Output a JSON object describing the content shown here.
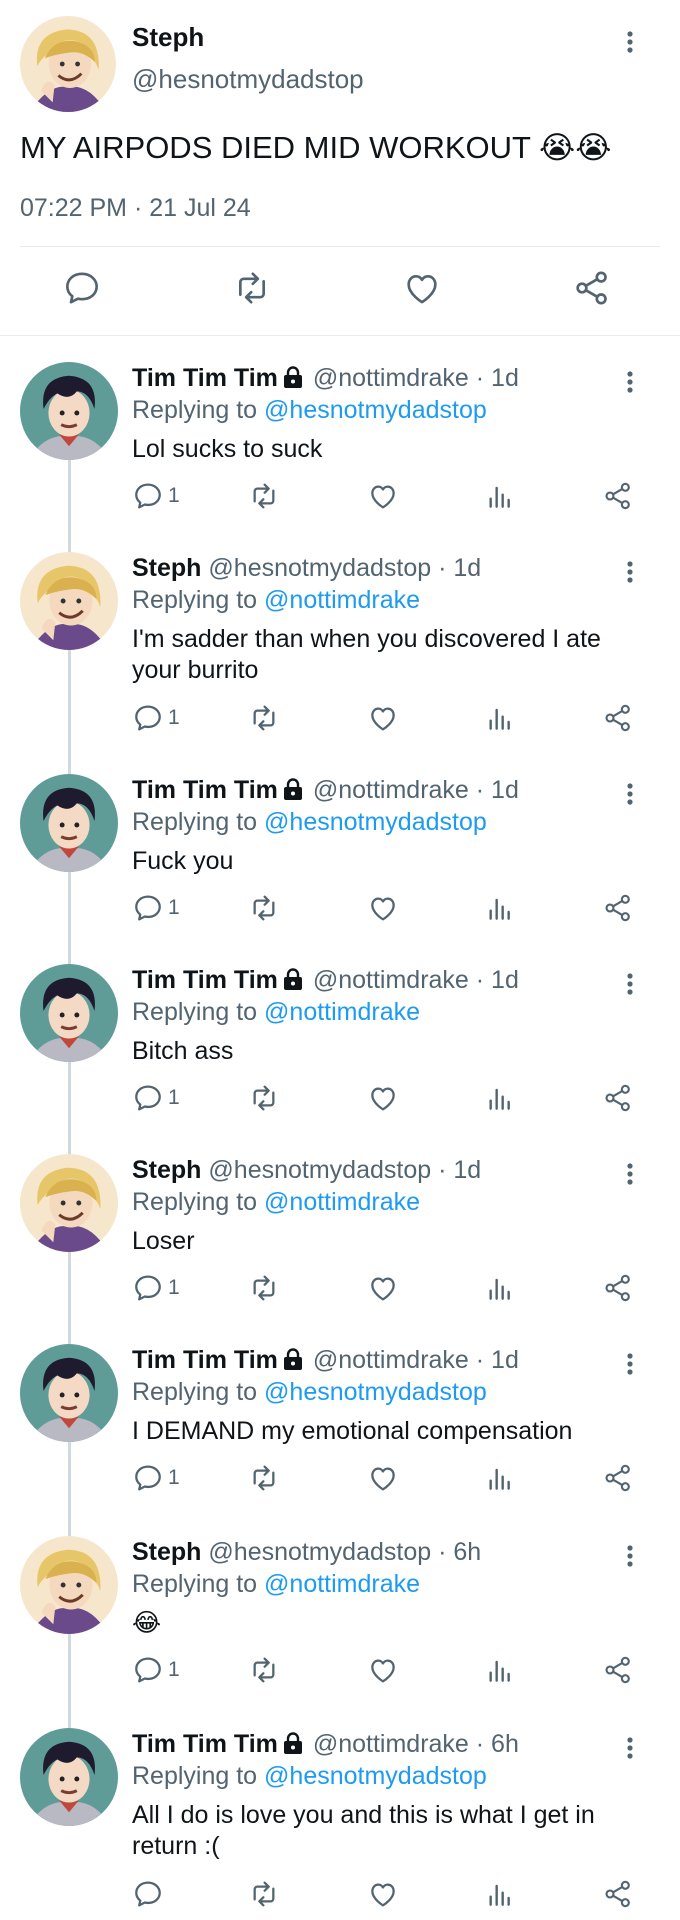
{
  "main_tweet": {
    "name": "Steph",
    "handle": "@hesnotmydadstop",
    "text": "MY AIRPODS DIED MID WORKOUT 😭😭",
    "timestamp": "07:22 PM · 21 Jul 24"
  },
  "replies": [
    {
      "name": "Tim Tim Tim",
      "handle": "@nottimdrake · 1d",
      "replying_prefix": "Replying to ",
      "replying_to": "@hesnotmydadstop",
      "text": "Lol sucks to suck",
      "reply_count": "1",
      "avatar": "tim"
    },
    {
      "name": "Steph",
      "handle": "@hesnotmydadstop · 1d",
      "replying_prefix": "Replying to ",
      "replying_to": "@nottimdrake",
      "text": "I'm sadder than when you discovered I ate your burrito",
      "reply_count": "1",
      "avatar": "steph"
    },
    {
      "name": "Tim Tim Tim",
      "handle": "@nottimdrake · 1d",
      "replying_prefix": "Replying to ",
      "replying_to": "@hesnotmydadstop",
      "text": "Fuck you",
      "reply_count": "1",
      "avatar": "tim"
    },
    {
      "name": "Tim Tim Tim",
      "handle": "@nottimdrake · 1d",
      "replying_prefix": "Replying to ",
      "replying_to": "@nottimdrake",
      "text": "Bitch ass",
      "reply_count": "1",
      "avatar": "tim"
    },
    {
      "name": "Steph",
      "handle": "@hesnotmydadstop · 1d",
      "replying_prefix": "Replying to ",
      "replying_to": "@nottimdrake",
      "text": "Loser",
      "reply_count": "1",
      "avatar": "steph"
    },
    {
      "name": "Tim Tim Tim",
      "handle": "@nottimdrake · 1d",
      "replying_prefix": "Replying to ",
      "replying_to": "@hesnotmydadstop",
      "text": "I DEMAND my emotional compensation",
      "reply_count": "1",
      "avatar": "tim"
    },
    {
      "name": "Steph",
      "handle": "@hesnotmydadstop · 6h",
      "replying_prefix": "Replying to ",
      "replying_to": "@nottimdrake",
      "text": "😂",
      "reply_count": "1",
      "avatar": "steph"
    },
    {
      "name": "Tim Tim Tim",
      "handle": "@nottimdrake · 6h",
      "replying_prefix": "Replying to ",
      "replying_to": "@hesnotmydadstop",
      "text": "All I do is love you and this is what I get in return :(",
      "reply_count": "",
      "avatar": "tim"
    }
  ],
  "icons": [
    "reply-icon",
    "retweet-icon",
    "like-icon",
    "views-icon",
    "share-icon",
    "more-icon",
    "lock-icon"
  ],
  "colors": {
    "text": "#0f1419",
    "secondary": "#536471",
    "link": "#1d9bf0",
    "divider": "#e6ecf0",
    "thread_line": "#cfd9de"
  }
}
